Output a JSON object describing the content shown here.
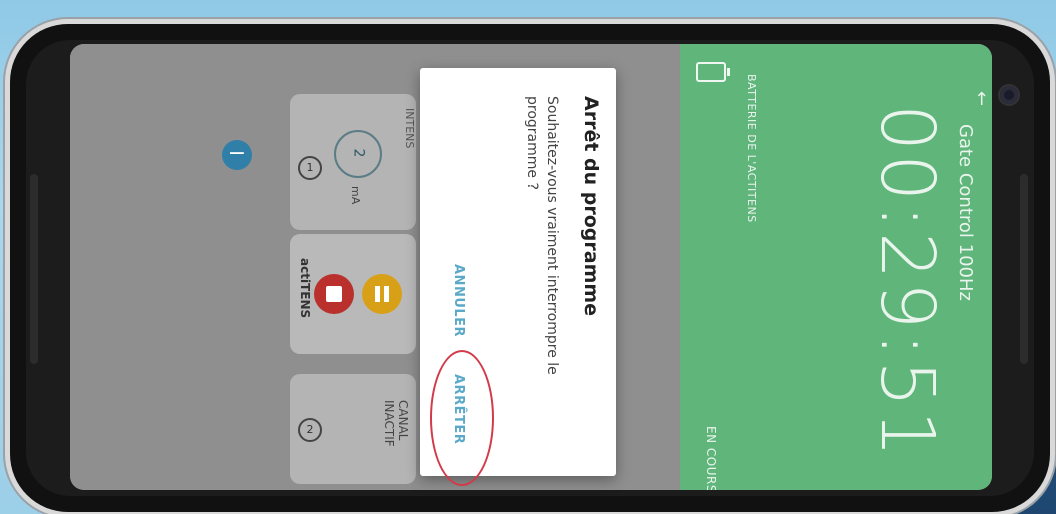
{
  "app": {
    "title": "Gate Control 100Hz",
    "timer": "00:29:51",
    "battery_label": "BATTERIE DE L'ACTITENS",
    "status": "EN COURS"
  },
  "channels": {
    "channel1_number": "1",
    "channel1_intensity": "2",
    "channel1_unit": "mA",
    "channel1_tag": "INTENS",
    "device_label": "actiTENS",
    "channel2_number": "2",
    "channel2_state": "CANAL INACTIF"
  },
  "controls": {
    "minus_symbol": "−"
  },
  "dialog": {
    "title": "Arrêt du programme",
    "message": "Souhaitez-vous vraiment interrompre le programme ?",
    "cancel_label": "ANNULER",
    "confirm_label": "ARRÊTER"
  },
  "colors": {
    "green_panel": "#5fb57a",
    "accent_button_text": "#5aa9c8",
    "stop_red": "#b9302c",
    "pause_yellow": "#d8a017",
    "annotation_red": "#d23a4a"
  }
}
